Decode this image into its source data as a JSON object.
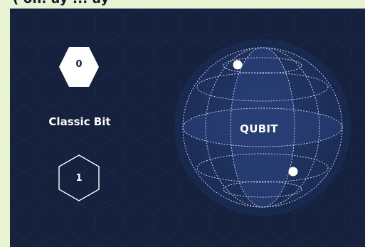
{
  "header": {
    "cut_off_text": "(           on.    ay     ...      ay"
  },
  "classic": {
    "state_zero": "0",
    "state_one": "1",
    "label": "Classic Bit"
  },
  "qubit": {
    "label": "QUBIT"
  },
  "colors": {
    "background_outer": "#e8f3d2",
    "panel": "#15213d",
    "sphere_fill": "#1f3363",
    "accent_white": "#ffffff"
  },
  "icons": {
    "zero_state": "hexagon-filled",
    "one_state": "hexagon-outline",
    "qubit_sphere": "bloch-sphere-wireframe"
  }
}
